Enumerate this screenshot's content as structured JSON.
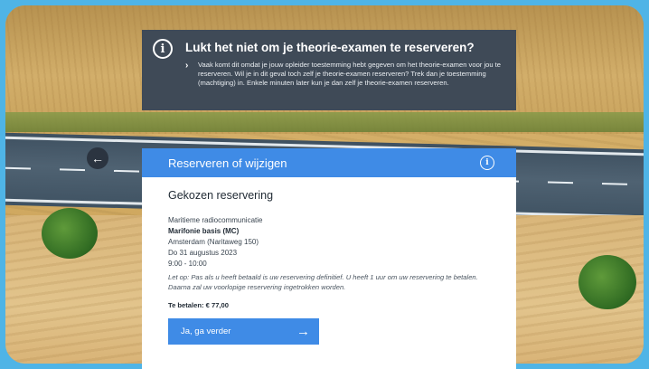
{
  "info_banner": {
    "title": "Lukt het niet om je theorie-examen te reserveren?",
    "text": "Vaak komt dit omdat je jouw opleider toestemming hebt gegeven om het theorie-examen voor jou te reserveren. Wil je in dit geval toch zelf je theorie-examen reserveren? Trek dan je toestemming (machtiging) in. Enkele minuten later kun je dan zelf je theorie-examen reserveren.",
    "icon": "info-icon",
    "chevron": "›"
  },
  "back": {
    "glyph": "←"
  },
  "modal": {
    "header": {
      "title": "Reserveren of wijzigen",
      "help_glyph": "i"
    },
    "section_title": "Gekozen reservering",
    "reservation": {
      "category": "Maritieme radiocommunicatie",
      "exam": "Marifonie basis (MC)",
      "location": "Amsterdam (Naritaweg 150)",
      "date": "Do 31 augustus 2023",
      "time": "9:00 - 10:00"
    },
    "note": "Let op: Pas als u heeft betaald is uw reservering definitief. U heeft 1 uur om uw reservering te betalen. Daarna zal uw voorlopige reservering ingetrokken worden.",
    "amount": "Te betalen: € 77,00",
    "primary_button": {
      "label": "Ja, ga verder",
      "arrow": "→"
    }
  },
  "colors": {
    "page_border": "#4fb4e6",
    "info_bg": "#3f4a57",
    "accent": "#3f8be6"
  }
}
